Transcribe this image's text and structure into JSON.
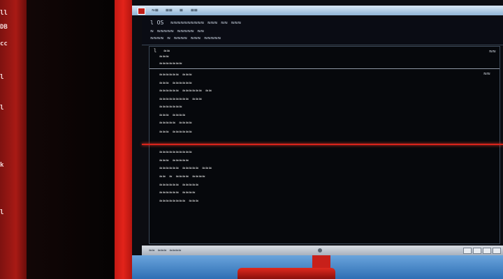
{
  "left_panel": {
    "labels": [
      "ll",
      "DB",
      "cc",
      "l",
      "l",
      "k",
      "l"
    ]
  },
  "titlebar": {
    "menu": [
      "≈≡",
      "≡≡",
      "≡",
      "≡≡"
    ]
  },
  "header": {
    "line1": "l OS  ≈≈≈≈≈≈≈≈≈≈ ≈≈≈ ≈≈ ≈≈≈",
    "line2": "≈ ≈≈≈≈≈ ≈≈≈≈≈ ≈≈",
    "line3": "≈≈≈≈ ≈ ≈≈≈≈ ≈≈≈ ≈≈≈≈≈"
  },
  "content": {
    "top_rows": [
      "l  ≈≈",
      "≈≈≈",
      "≈≈≈≈≈≈≈"
    ],
    "mid_rows": [
      "≈≈≈≈≈≈ ≈≈≈",
      "≈≈≈ ≈≈≈≈≈≈",
      "≈≈≈≈≈≈ ≈≈≈≈≈≈ ≈≈",
      "≈≈≈≈≈≈≈≈≈ ≈≈≈",
      "≈≈≈≈≈≈≈",
      "≈≈≈ ≈≈≈≈",
      "≈≈≈≈≈ ≈≈≈≈",
      "≈≈≈ ≈≈≈≈≈≈"
    ],
    "low_rows": [
      "≈≈≈≈≈≈≈≈≈≈",
      "≈≈≈ ≈≈≈≈≈",
      "≈≈≈≈≈≈ ≈≈≈≈≈ ≈≈≈",
      "≈≈ ≈ ≈≈≈≈ ≈≈≈≈",
      "≈≈≈≈≈≈ ≈≈≈≈≈",
      "≈≈≈≈≈≈ ≈≈≈≈",
      "≈≈≈≈≈≈≈≈ ≈≈≈"
    ],
    "corner_top": "≈≈",
    "corner_mid": "≈≈"
  },
  "statusbar": {
    "left": "≈≈ ≈≈≈ ≈≈≈≈"
  }
}
